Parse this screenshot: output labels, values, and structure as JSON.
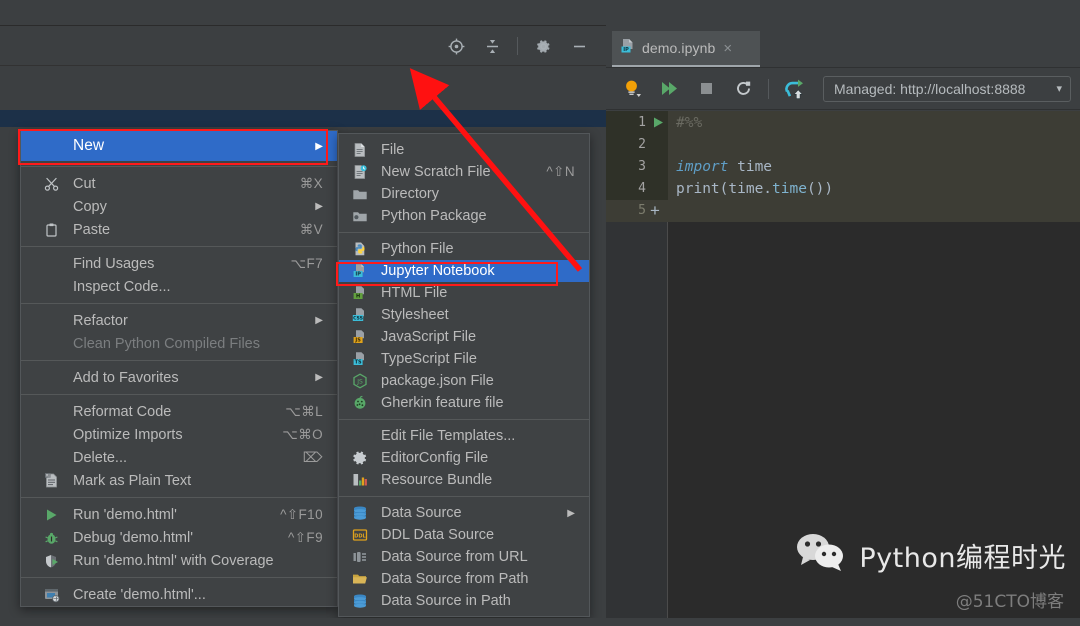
{
  "window": {
    "background_color": "#3c3f41",
    "accent_color": "#2f6bc8",
    "annotation_color": "#ff1a1a"
  },
  "project_toolbar": {
    "icons": [
      {
        "name": "locate-target-icon",
        "glyph": "locate"
      },
      {
        "name": "collapse-all-icon",
        "glyph": "collapse"
      },
      {
        "name": "settings-gear-icon",
        "glyph": "gear"
      },
      {
        "name": "hide-panel-icon",
        "glyph": "minus"
      }
    ]
  },
  "editor": {
    "tab": {
      "label": "demo.ipynb",
      "icon": "jupyter-notebook-file-icon",
      "close_label": "×"
    },
    "notebook_toolbar": {
      "buttons": [
        {
          "name": "run-cell-and-select-icon",
          "glyph": "bulb"
        },
        {
          "name": "run-all-cells-icon",
          "glyph": "double-play"
        },
        {
          "name": "stop-kernel-icon",
          "glyph": "stop"
        },
        {
          "name": "restart-kernel-icon",
          "glyph": "restart"
        },
        {
          "name": "upload-notebook-icon",
          "glyph": "upload"
        }
      ],
      "server_select": {
        "value": "Managed: http://localhost:8888",
        "caret": "▾"
      }
    },
    "code": {
      "lines": [
        {
          "number": "1",
          "run_marker": true,
          "segments": [
            {
              "text": "#%%",
              "style": "comment"
            }
          ]
        },
        {
          "number": "2",
          "run_marker": false,
          "segments": []
        },
        {
          "number": "3",
          "run_marker": false,
          "segments": [
            {
              "text": "import ",
              "style": "kw"
            },
            {
              "text": "time",
              "style": "plain"
            }
          ]
        },
        {
          "number": "4",
          "run_marker": false,
          "segments": [
            {
              "text": "print(time.",
              "style": "plain"
            },
            {
              "text": "time",
              "style": "attr"
            },
            {
              "text": "())",
              "style": "plain"
            }
          ]
        }
      ],
      "add_cell_line_number": "5",
      "add_cell_glyph": "+"
    }
  },
  "context_menu": {
    "groups": [
      {
        "items": [
          {
            "label": "New",
            "icon": "",
            "shortcut": "",
            "arrow": true,
            "selected": true,
            "highlighted_box": true,
            "name": "menu-item-new"
          }
        ]
      },
      {
        "items": [
          {
            "label": "Cut",
            "icon": "scissors-icon",
            "shortcut": "⌘X",
            "arrow": false,
            "name": "menu-item-cut"
          },
          {
            "label": "Copy",
            "icon": "",
            "shortcut": "",
            "arrow": true,
            "name": "menu-item-copy"
          },
          {
            "label": "Paste",
            "icon": "clipboard-icon",
            "shortcut": "⌘V",
            "arrow": false,
            "name": "menu-item-paste"
          }
        ]
      },
      {
        "items": [
          {
            "label": "Find Usages",
            "icon": "",
            "shortcut": "⌥F7",
            "arrow": false,
            "name": "menu-item-find-usages"
          },
          {
            "label": "Inspect Code...",
            "icon": "",
            "shortcut": "",
            "arrow": false,
            "name": "menu-item-inspect-code"
          }
        ]
      },
      {
        "items": [
          {
            "label": "Refactor",
            "icon": "",
            "shortcut": "",
            "arrow": true,
            "name": "menu-item-refactor"
          },
          {
            "label": "Clean Python Compiled Files",
            "icon": "",
            "shortcut": "",
            "arrow": false,
            "disabled": true,
            "name": "menu-item-clean-python-compiled-files"
          }
        ]
      },
      {
        "items": [
          {
            "label": "Add to Favorites",
            "icon": "",
            "shortcut": "",
            "arrow": true,
            "name": "menu-item-add-to-favorites"
          }
        ]
      },
      {
        "items": [
          {
            "label": "Reformat Code",
            "icon": "",
            "shortcut": "⌥⌘L",
            "arrow": false,
            "name": "menu-item-reformat-code"
          },
          {
            "label": "Optimize Imports",
            "icon": "",
            "shortcut": "⌥⌘O",
            "arrow": false,
            "name": "menu-item-optimize-imports"
          },
          {
            "label": "Delete...",
            "icon": "",
            "shortcut": "⌦",
            "arrow": false,
            "name": "menu-item-delete"
          },
          {
            "label": "Mark as Plain Text",
            "icon": "plain-text-file-icon",
            "shortcut": "",
            "arrow": false,
            "name": "menu-item-mark-as-plain-text"
          }
        ]
      },
      {
        "items": [
          {
            "label": "Run 'demo.html'",
            "icon": "run-play-icon",
            "shortcut": "^⇧F10",
            "arrow": false,
            "name": "menu-item-run-demo-html"
          },
          {
            "label": "Debug 'demo.html'",
            "icon": "debug-bug-icon",
            "shortcut": "^⇧F9",
            "arrow": false,
            "name": "menu-item-debug-demo-html"
          },
          {
            "label": "Run 'demo.html' with Coverage",
            "icon": "coverage-icon",
            "shortcut": "",
            "arrow": false,
            "name": "menu-item-run-with-coverage"
          }
        ]
      },
      {
        "items": [
          {
            "label": "Create 'demo.html'...",
            "icon": "create-config-icon",
            "shortcut": "",
            "arrow": false,
            "name": "menu-item-create-demo-html"
          }
        ]
      }
    ]
  },
  "new_submenu": {
    "groups": [
      {
        "items": [
          {
            "label": "File",
            "icon": "file-icon",
            "shortcut": "",
            "arrow": false,
            "name": "submenu-item-file"
          },
          {
            "label": "New Scratch File",
            "icon": "scratch-file-icon",
            "shortcut": "^⇧N",
            "arrow": false,
            "name": "submenu-item-new-scratch-file"
          },
          {
            "label": "Directory",
            "icon": "folder-icon",
            "shortcut": "",
            "arrow": false,
            "name": "submenu-item-directory"
          },
          {
            "label": "Python Package",
            "icon": "python-package-icon",
            "shortcut": "",
            "arrow": false,
            "name": "submenu-item-python-package"
          }
        ]
      },
      {
        "items": [
          {
            "label": "Python File",
            "icon": "python-file-icon",
            "shortcut": "",
            "arrow": false,
            "name": "submenu-item-python-file"
          },
          {
            "label": "Jupyter Notebook",
            "icon": "jupyter-notebook-icon",
            "shortcut": "",
            "arrow": false,
            "selected": true,
            "highlighted_box": true,
            "name": "submenu-item-jupyter-notebook"
          },
          {
            "label": "HTML File",
            "icon": "html-file-icon",
            "shortcut": "",
            "arrow": false,
            "name": "submenu-item-html-file"
          },
          {
            "label": "Stylesheet",
            "icon": "css-file-icon",
            "shortcut": "",
            "arrow": false,
            "name": "submenu-item-stylesheet"
          },
          {
            "label": "JavaScript File",
            "icon": "js-file-icon",
            "shortcut": "",
            "arrow": false,
            "name": "submenu-item-javascript-file"
          },
          {
            "label": "TypeScript File",
            "icon": "ts-file-icon",
            "shortcut": "",
            "arrow": false,
            "name": "submenu-item-typescript-file"
          },
          {
            "label": "package.json File",
            "icon": "npm-package-json-icon",
            "shortcut": "",
            "arrow": false,
            "name": "submenu-item-package-json-file"
          },
          {
            "label": "Gherkin feature file",
            "icon": "gherkin-cucumber-icon",
            "shortcut": "",
            "arrow": false,
            "name": "submenu-item-gherkin-feature-file"
          }
        ]
      },
      {
        "items": [
          {
            "label": "Edit File Templates...",
            "icon": "",
            "shortcut": "",
            "arrow": false,
            "name": "submenu-item-edit-file-templates"
          },
          {
            "label": "EditorConfig File",
            "icon": "editorconfig-gear-icon",
            "shortcut": "",
            "arrow": false,
            "name": "submenu-item-editorconfig-file"
          },
          {
            "label": "Resource Bundle",
            "icon": "resource-bundle-icon",
            "shortcut": "",
            "arrow": false,
            "name": "submenu-item-resource-bundle"
          }
        ]
      },
      {
        "items": [
          {
            "label": "Data Source",
            "icon": "database-icon",
            "shortcut": "",
            "arrow": true,
            "name": "submenu-item-data-source"
          },
          {
            "label": "DDL Data Source",
            "icon": "ddl-icon",
            "shortcut": "",
            "arrow": false,
            "name": "submenu-item-ddl-data-source"
          },
          {
            "label": "Data Source from URL",
            "icon": "data-source-url-icon",
            "shortcut": "",
            "arrow": false,
            "name": "submenu-item-data-source-from-url"
          },
          {
            "label": "Data Source from Path",
            "icon": "open-folder-icon",
            "shortcut": "",
            "arrow": false,
            "name": "submenu-item-data-source-from-path"
          },
          {
            "label": "Data Source in Path",
            "icon": "database-icon",
            "shortcut": "",
            "arrow": false,
            "name": "submenu-item-data-source-in-path"
          }
        ]
      }
    ]
  },
  "watermark": {
    "title": "Python编程时光",
    "credit": "@51CTO博客",
    "icon": "wechat-icon"
  }
}
